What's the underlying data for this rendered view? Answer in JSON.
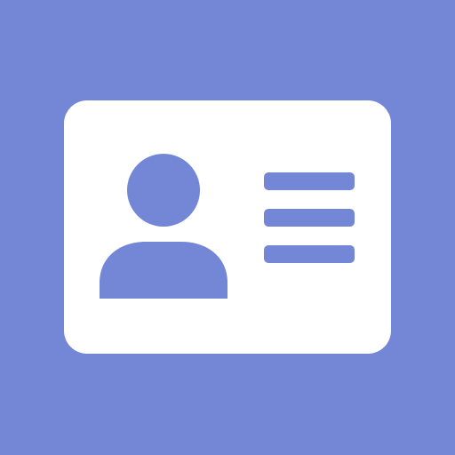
{
  "icon": {
    "name": "id-card-icon",
    "background_color": "#7387d6",
    "card_color": "#ffffff",
    "glyph_color": "#7387d6"
  }
}
